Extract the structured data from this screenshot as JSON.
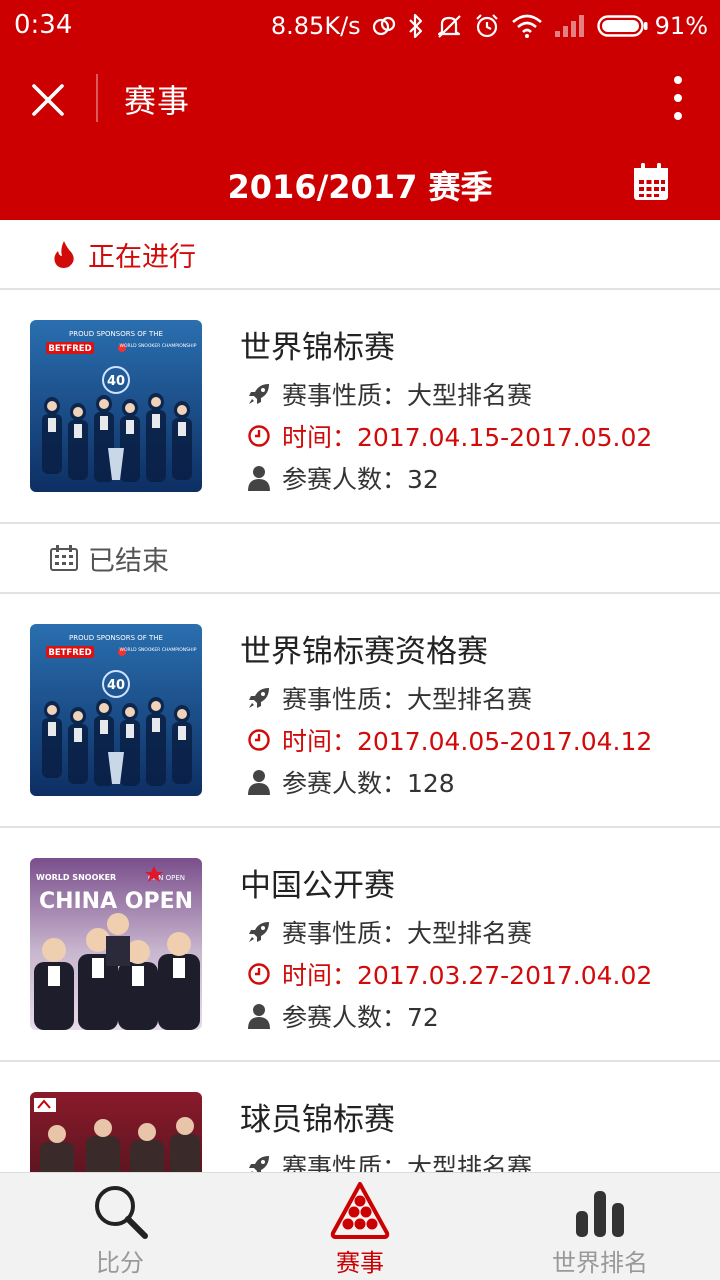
{
  "status_bar": {
    "time": "0:34",
    "net_speed": "8.85K/s",
    "battery": "91%"
  },
  "header": {
    "title": "赛事",
    "season": "2016/2017 赛季"
  },
  "sections": {
    "ongoing": {
      "label": "正在进行"
    },
    "finished": {
      "label": "已结束"
    }
  },
  "events": [
    {
      "name": "世界锦标赛",
      "type": "赛事性质：大型排名赛",
      "time": "时间：2017.04.15-2017.05.02",
      "players": "参赛人数：32",
      "poster": {
        "top_text": "PROUD SPONSORS OF THE",
        "brand": "BETFRED",
        "sub": "WORLD SNOOKER CHAMPIONSHIP",
        "badge": "40"
      }
    },
    {
      "name": "世界锦标赛资格赛",
      "type": "赛事性质：大型排名赛",
      "time": "时间：2017.04.05-2017.04.12",
      "players": "参赛人数：128",
      "poster": {
        "top_text": "PROUD SPONSORS OF THE",
        "brand": "BETFRED",
        "sub": "WORLD SNOOKER CHAMPIONSHIP",
        "badge": "40"
      }
    },
    {
      "name": "中国公开赛",
      "type": "赛事性质：大型排名赛",
      "time": "时间：2017.03.27-2017.04.02",
      "players": "参赛人数：72",
      "poster": {
        "top_text": "WORLD SNOOKER",
        "brand": "CHINA OPEN",
        "logo": "CHN OPEN"
      }
    },
    {
      "name": "球员锦标赛",
      "type": "赛事性质：大型排名赛"
    }
  ],
  "tabs": [
    {
      "label": "比分",
      "icon": "search-icon",
      "active": false
    },
    {
      "label": "赛事",
      "icon": "snooker-balls-icon",
      "active": true
    },
    {
      "label": "世界排名",
      "icon": "bar-chart-icon",
      "active": false
    }
  ],
  "colors": {
    "primary_red": "#cc0000",
    "accent_red": "#d10a0a",
    "tab_inactive": "#999999"
  }
}
